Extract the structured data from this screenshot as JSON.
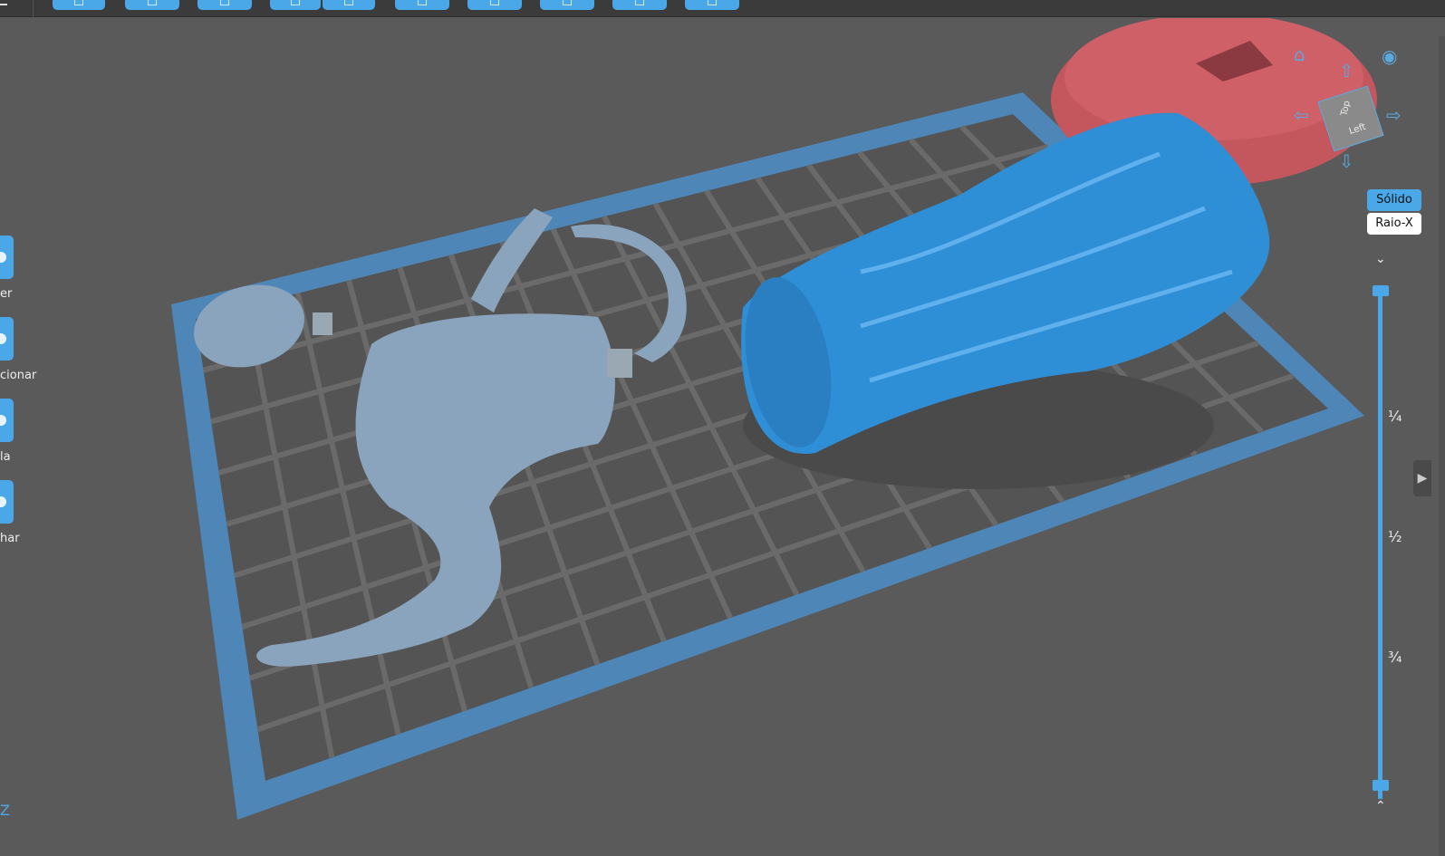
{
  "left_toolbar": {
    "items": [
      {
        "label": "er",
        "icon": "move-icon"
      },
      {
        "label": "cionar",
        "icon": "rotate-icon"
      },
      {
        "label": "la",
        "icon": "scale-icon"
      },
      {
        "label": "har",
        "icon": "mirror-icon"
      }
    ]
  },
  "view_controls": {
    "cube_top": "Top",
    "cube_left": "Left",
    "modes": [
      {
        "label": "Sólido",
        "active": true
      },
      {
        "label": "Raio-X",
        "active": false
      }
    ]
  },
  "layer_slider": {
    "ticks": [
      "¼",
      "½",
      "¾"
    ],
    "top_value": 1.0,
    "bottom_value": 0.0
  },
  "axis_indicator": {
    "label": "Z"
  },
  "colors": {
    "accent": "#4aa8e8",
    "background": "#5a5a5a",
    "model_selected": "#2f8fd6",
    "model_unselected": "#7d9bb8",
    "model_other": "#c4565e"
  }
}
